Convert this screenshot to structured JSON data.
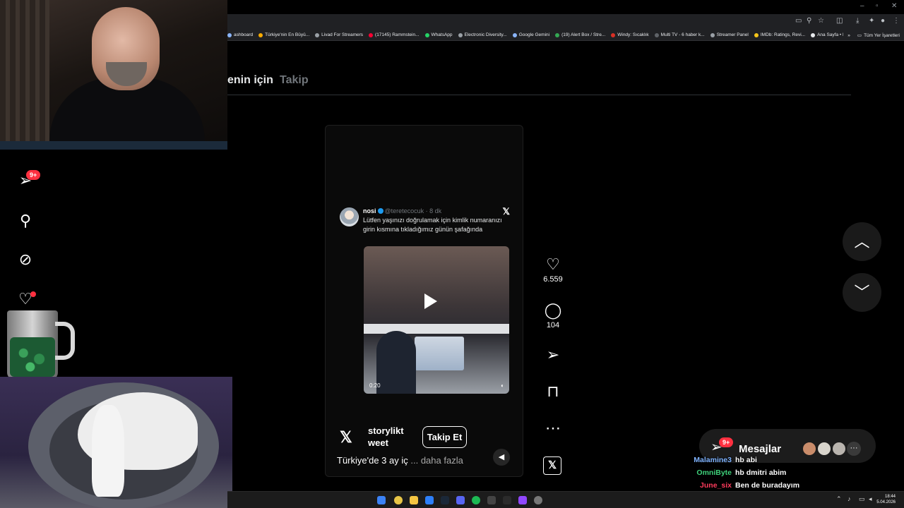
{
  "browser": {
    "window_controls": [
      "–",
      "▫",
      "✕"
    ],
    "toolbar_icons": [
      "cast-icon",
      "zoom-icon",
      "star-icon",
      "extensions-icon",
      "download-icon",
      "puzzle-icon",
      "profile-icon",
      "menu-icon"
    ],
    "bookmarks": [
      {
        "label": "ashboard",
        "color": "#8ab4f8"
      },
      {
        "label": "Türkiye'nin En Büyü...",
        "color": "#f9ab00"
      },
      {
        "label": "Livad For Streamers",
        "color": "#9aa0a6"
      },
      {
        "label": "(17145) Rammstein...",
        "color": "#ff0033"
      },
      {
        "label": "WhatsApp",
        "color": "#25d366"
      },
      {
        "label": "Electronic Diversity...",
        "color": "#9aa0a6"
      },
      {
        "label": "Google Gemini",
        "color": "#8ab4f8"
      },
      {
        "label": "(19) Alert Box / Stre...",
        "color": "#34a853"
      },
      {
        "label": "Windy: Sıcaklık",
        "color": "#d93025"
      },
      {
        "label": "Multi TV - 6 haber k...",
        "color": "#5f6368"
      },
      {
        "label": "Streamer Panel",
        "color": "#9aa0a6"
      },
      {
        "label": "IMDb: Ratings, Revi...",
        "color": "#f5c518"
      },
      {
        "label": "Ana Sayfa • HBO Max",
        "color": "#e8eaed"
      }
    ],
    "bookmarks_overflow": "»",
    "all_bookmarks": "Tüm Yer İşaretleri"
  },
  "feed": {
    "tab_for_you": "enin için",
    "tab_following": "Takip"
  },
  "sidebar": {
    "notifications_badge": "9+"
  },
  "reel": {
    "tweet": {
      "name": "nosi",
      "handle": "@teretecocuk · 8 dk",
      "text": "Lütfen yaşınızı doğrulamak için kimlik numaranızı girin kısmına tıkladığımız günün şafağında",
      "video_time": "0:20",
      "x_mark": "𝕏"
    },
    "author_name": "storylikt weet",
    "follow_label": "Takip Et",
    "caption": "Türkiye'de 3 ay iç",
    "caption_more": "... daha fazla",
    "author_icon": "𝕏"
  },
  "actions": {
    "likes": "6.559",
    "comments": "104",
    "x_button": "𝕏"
  },
  "messages": {
    "label": "Mesajlar",
    "badge": "9+",
    "more": "···",
    "avatar_colors": [
      "#c98c6a",
      "#d8d4cc",
      "#b9b4ae"
    ]
  },
  "chat": [
    {
      "user": "Malamine3",
      "message": "hb abi",
      "color": "#7fb3ff"
    },
    {
      "user": "OmniByte",
      "message": "hb dmitri abim",
      "color": "#3ed17a"
    },
    {
      "user": "June_six",
      "message": "Ben de buradayım",
      "color": "#ff3b5c"
    },
    {
      "user": "June_six",
      "message": "",
      "color": "#ff3b5c"
    }
  ],
  "taskbar": {
    "time": "18:44",
    "date": "5.04.2026"
  }
}
